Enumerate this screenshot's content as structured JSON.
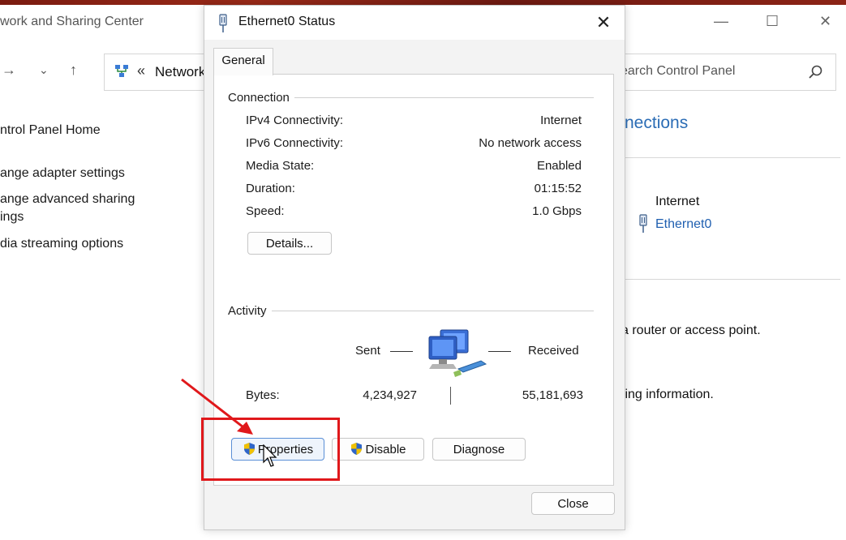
{
  "background_window": {
    "title": "work and Sharing Center",
    "controls": {
      "minimize": "—",
      "maximize": "☐",
      "close": "✕"
    },
    "nav": {
      "forward": "→",
      "dropdown": "⌄",
      "up": "↑"
    },
    "address": {
      "separator": "«",
      "text": "Network"
    },
    "search": {
      "placeholder": "earch Control Panel"
    },
    "sidebar": {
      "home": "ntrol Panel Home",
      "links": [
        "ange adapter settings",
        "ange advanced sharing",
        "ings",
        "dia streaming options"
      ]
    },
    "main": {
      "heading": "nections",
      "network_type": "Internet",
      "connections_colon": ":",
      "connection_link": "Ethernet0",
      "line1": "a router or access point.",
      "line2": "ting information."
    }
  },
  "dialog": {
    "title": "Ethernet0 Status",
    "close_glyph": "✕",
    "tab": "General",
    "connection": {
      "group_label": "Connection",
      "rows": [
        {
          "label": "IPv4 Connectivity:",
          "value": "Internet"
        },
        {
          "label": "IPv6 Connectivity:",
          "value": "No network access"
        },
        {
          "label": "Media State:",
          "value": "Enabled"
        },
        {
          "label": "Duration:",
          "value": "01:15:52"
        },
        {
          "label": "Speed:",
          "value": "1.0 Gbps"
        }
      ],
      "details_button": "Details..."
    },
    "activity": {
      "group_label": "Activity",
      "sent_label": "Sent",
      "received_label": "Received",
      "bytes_label": "Bytes:",
      "bytes_sent": "4,234,927",
      "bytes_received": "55,181,693"
    },
    "buttons": {
      "properties": "Properties",
      "disable": "Disable",
      "diagnose": "Diagnose",
      "close": "Close"
    }
  },
  "colors": {
    "annotation_red": "#e0181b",
    "link_blue": "#1f5fb0",
    "heading_blue": "#2a6cb5"
  }
}
